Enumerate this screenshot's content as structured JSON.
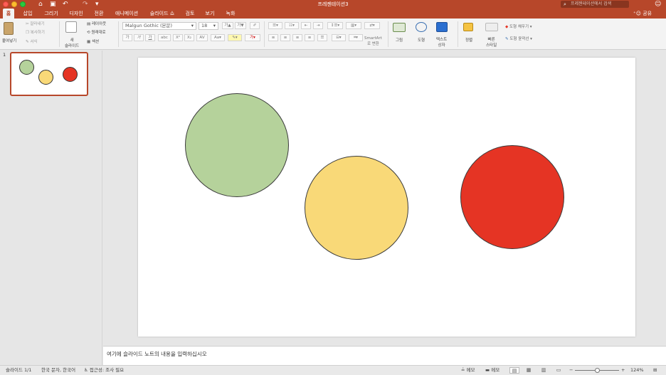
{
  "titlebar": {
    "doc_title": "프레젠테이션3",
    "search_placeholder": "프레젠테이션에서 검색",
    "qat_undo": "↶",
    "qat_redo": "↷",
    "qat_more": "▾"
  },
  "tabs": [
    {
      "label": "홈",
      "active": true
    },
    {
      "label": "삽입"
    },
    {
      "label": "그리기"
    },
    {
      "label": "디자인"
    },
    {
      "label": "전환"
    },
    {
      "label": "애니메이션"
    },
    {
      "label": "슬라이드 쇼"
    },
    {
      "label": "검토"
    },
    {
      "label": "보기"
    },
    {
      "label": "녹화"
    }
  ],
  "share_label": "공유",
  "ribbon": {
    "paste": "붙여넣기",
    "cut": "잘라내기",
    "copy": "복사하기",
    "format": "서식",
    "new_slide": "새\n슬라이드",
    "layout": "레이아웃",
    "reset": "원래대로",
    "section": "섹션",
    "font_name": "Malgun Gothic (본문)",
    "font_size": "18",
    "smartart": "SmartArt\n로 변환",
    "picture": "그림",
    "shapes": "도형",
    "textbox": "텍스트\n상자",
    "arrange": "정렬",
    "quick_styles": "빠른\n스타일",
    "shape_fill": "도형 채우기",
    "shape_outline": "도형 윤곽선"
  },
  "thumbnail": {
    "slide_number": "1"
  },
  "slide": {
    "circles": [
      {
        "name": "green-circle",
        "color": "#b5d29b"
      },
      {
        "name": "yellow-circle",
        "color": "#f9d978"
      },
      {
        "name": "red-circle",
        "color": "#e53424"
      }
    ]
  },
  "notes_placeholder": "여기에 슬라이드 노트의 내용을 입력하십시오",
  "status": {
    "slide_count": "슬라이드 1/1",
    "language": "한국 문자, 한국어",
    "accessibility": "접근성: 조사 필요",
    "notes": "메모",
    "comments": "메모",
    "zoom": "124%"
  }
}
